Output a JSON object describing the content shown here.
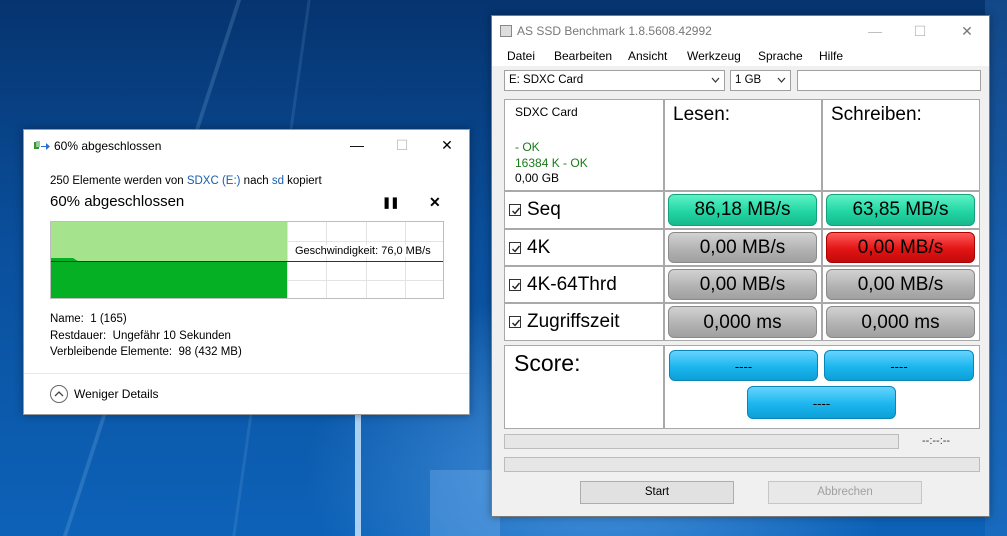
{
  "copy_dialog": {
    "title": "60% abgeschlossen",
    "desc_prefix": "250 Elemente werden von ",
    "desc_source": "SDXC (E:)",
    "desc_mid": " nach ",
    "desc_dest": "sd",
    "desc_suffix": " kopiert",
    "heading": "60% abgeschlossen",
    "progress": 0.6,
    "speed_label": "Geschwindigkeit: 76,0 MB/s",
    "name_label": "Name:",
    "name_value": "1 (165)",
    "remaining_time_label": "Restdauer:",
    "remaining_time_value": "Ungefähr 10 Sekunden",
    "remaining_items_label": "Verbleibende Elemente:",
    "remaining_items_value": "98 (432 MB)",
    "less_details": "Weniger Details",
    "pause_icon": "pause-icon",
    "cancel_icon": "close-icon",
    "done_color": "#06b025",
    "window_minimize": "—",
    "window_maximize": "☐",
    "window_close": "✕"
  },
  "as_ssd": {
    "title": "AS SSD Benchmark 1.8.5608.42992",
    "window_minimize": "—",
    "window_maximize": "☐",
    "window_close": "✕",
    "menu": [
      "Datei",
      "Bearbeiten",
      "Ansicht",
      "Werkzeug",
      "Sprache",
      "Hilfe"
    ],
    "drive_select": "E: SDXC Card",
    "size_select": "1 GB",
    "text_field": "",
    "drive_info": {
      "name": "SDXC Card",
      "line1": " - OK",
      "line2": "16384 K - OK",
      "line3": "0,00 GB"
    },
    "col_read": "Lesen:",
    "col_write": "Schreiben:",
    "rows": [
      {
        "label": "Seq",
        "read": "86,18 MB/s",
        "write": "63,85 MB/s",
        "checked": true
      },
      {
        "label": "4K",
        "read": "0,00 MB/s",
        "write": "0,00 MB/s",
        "checked": true
      },
      {
        "label": "4K-64Thrd",
        "read": "0,00 MB/s",
        "write": "0,00 MB/s",
        "checked": true
      },
      {
        "label": "Zugriffszeit",
        "read": "0,000 ms",
        "write": "0,000 ms",
        "checked": true
      }
    ],
    "score_label": "Score:",
    "score_read": "----",
    "score_write": "----",
    "score_total": "----",
    "time_label": "--:--:--",
    "start_button": "Start",
    "abort_button": "Abbrechen",
    "colors": {
      "good": "#22d6a4",
      "neutral": "#b3b3b3",
      "bad": "#e31414",
      "score": "#1bb6ee"
    }
  }
}
